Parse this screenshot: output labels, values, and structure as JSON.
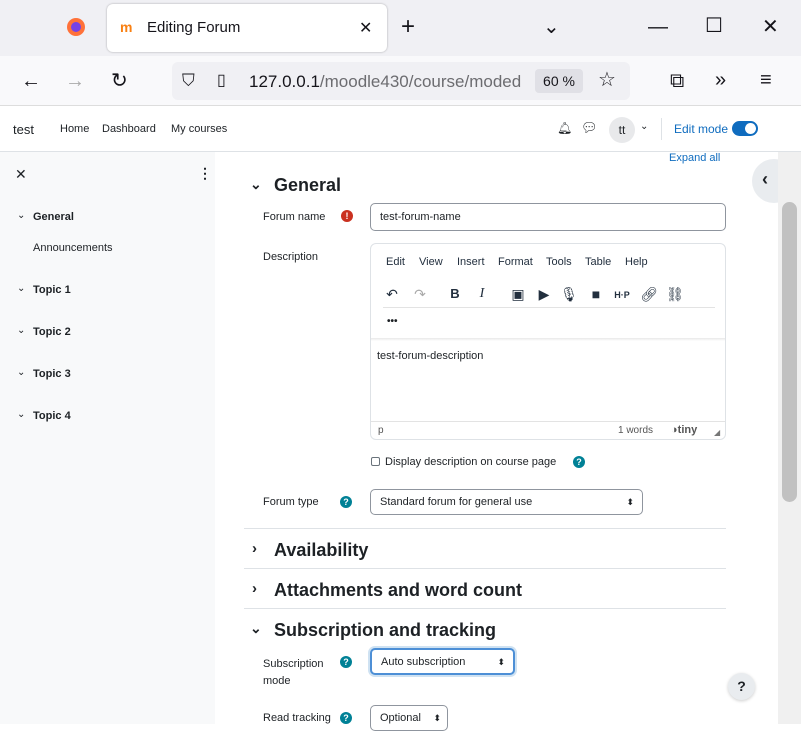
{
  "browser": {
    "tab_title": "Editing Forum",
    "url_host": "127.0.0.1",
    "url_path": "/moodle430/course/moded",
    "zoom": "60 %"
  },
  "header": {
    "site_name": "test",
    "nav": [
      "Home",
      "Dashboard",
      "My courses"
    ],
    "avatar": "tt",
    "edit_mode": "Edit mode"
  },
  "drawer": {
    "items": [
      {
        "label": "General"
      },
      {
        "label": "Announcements"
      },
      {
        "label": "Topic 1"
      },
      {
        "label": "Topic 2"
      },
      {
        "label": "Topic 3"
      },
      {
        "label": "Topic 4"
      }
    ]
  },
  "main": {
    "expand_all": "Expand all",
    "general_title": "General",
    "forum_name_label": "Forum name",
    "forum_name_value": "test-forum-name",
    "description_label": "Description",
    "editor_menu": [
      "Edit",
      "View",
      "Insert",
      "Format",
      "Tools",
      "Table",
      "Help"
    ],
    "editor_more": "•••",
    "editor_content": "test-forum-description",
    "editor_path": "p",
    "editor_words": "1 words",
    "editor_brand": "tiny",
    "display_description_label": "Display description on course page",
    "forum_type_label": "Forum type",
    "forum_type_value": "Standard forum for general use",
    "availability_title": "Availability",
    "attachments_title": "Attachments and word count",
    "subscription_title": "Subscription and tracking",
    "subscription_mode_label_1": "Subscription",
    "subscription_mode_label_2": "mode",
    "subscription_mode_value": "Auto subscription",
    "read_tracking_label": "Read tracking",
    "read_tracking_value": "Optional"
  },
  "colors": {
    "accent": "#0f6cbf",
    "help": "#008196",
    "required": "#ca3120"
  }
}
